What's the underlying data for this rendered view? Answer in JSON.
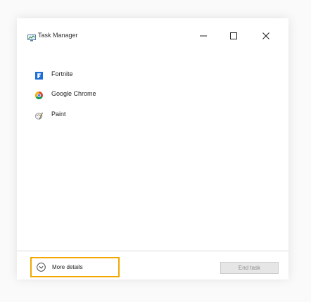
{
  "window": {
    "title": "Task Manager",
    "controls": {
      "minimize_icon": "minimize-icon",
      "maximize_icon": "maximize-icon",
      "close_icon": "close-icon"
    }
  },
  "apps": [
    {
      "name": "Fortnite",
      "icon": "fortnite-icon"
    },
    {
      "name": "Google Chrome",
      "icon": "chrome-icon"
    },
    {
      "name": "Paint",
      "icon": "paint-icon"
    }
  ],
  "footer": {
    "more_details_label": "More details",
    "end_task_label": "End task"
  },
  "colors": {
    "highlight": "#f2a800",
    "fortnite_blue": "#1e6fd9",
    "disabled_text": "#8a8a8a"
  }
}
